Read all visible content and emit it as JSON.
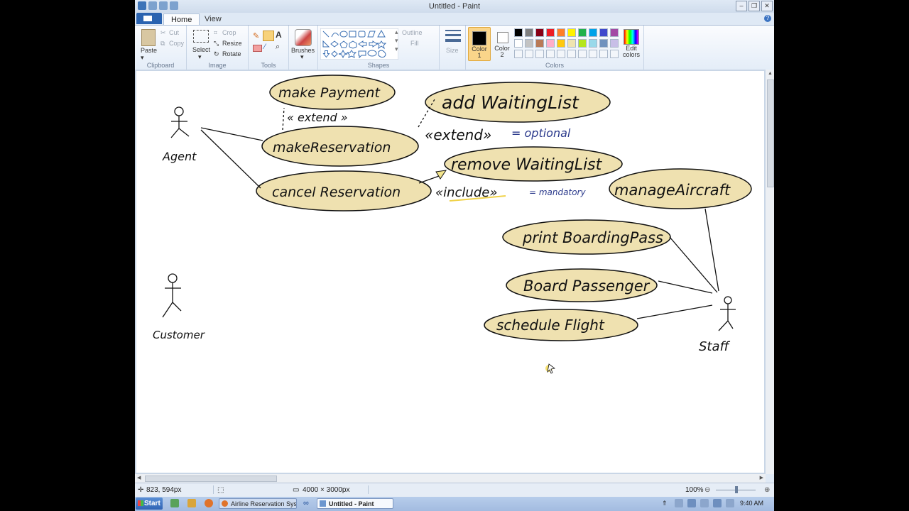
{
  "window": {
    "title": "Untitled - Paint",
    "tabs": [
      "Home",
      "View"
    ]
  },
  "ribbon": {
    "clipboard": {
      "paste": "Paste",
      "cut": "Cut",
      "copy": "Copy",
      "group": "Clipboard"
    },
    "image": {
      "select": "Select",
      "crop": "Crop",
      "resize": "Resize",
      "rotate": "Rotate",
      "group": "Image"
    },
    "tools": {
      "group": "Tools",
      "text_tool": "A"
    },
    "brushes": "Brushes",
    "shapes": {
      "outline": "Outline",
      "fill": "Fill",
      "group": "Shapes"
    },
    "size": "Size",
    "color1": "Color 1",
    "color2": "Color 2",
    "colors_group": "Colors",
    "edit_colors": "Edit colors",
    "palette": [
      "#000000",
      "#7f7f7f",
      "#880015",
      "#ed1c24",
      "#ff7f27",
      "#fff200",
      "#22b14c",
      "#00a2e8",
      "#3f48cc",
      "#a349a4",
      "#ffffff",
      "#c3c3c3",
      "#b97a57",
      "#ffaec9",
      "#ffc90e",
      "#efe4b0",
      "#b5e61d",
      "#99d9ea",
      "#7092be",
      "#c8bfe7"
    ]
  },
  "diagram": {
    "use_cases": [
      "make Payment",
      "add WaitingList",
      "makeReservation",
      "remove WaitingList",
      "cancel Reservation",
      "manageAircraft",
      "print BoardingPass",
      "Board Passenger",
      "schedule Flight"
    ],
    "actors": [
      "Agent",
      "Customer",
      "Staff"
    ],
    "notes": {
      "extend_small": "« extend »",
      "extend": "«extend»",
      "optional": "= optional",
      "include": "«include»",
      "mandatory": "= mandatory"
    }
  },
  "status": {
    "cursor_pos": "823, 594px",
    "image_size": "4000 × 3000px",
    "zoom": "100%"
  },
  "taskbar": {
    "start": "Start",
    "item1": "Airline Reservation Syste...",
    "item2": "Untitled - Paint",
    "clock": "9:40 AM"
  }
}
